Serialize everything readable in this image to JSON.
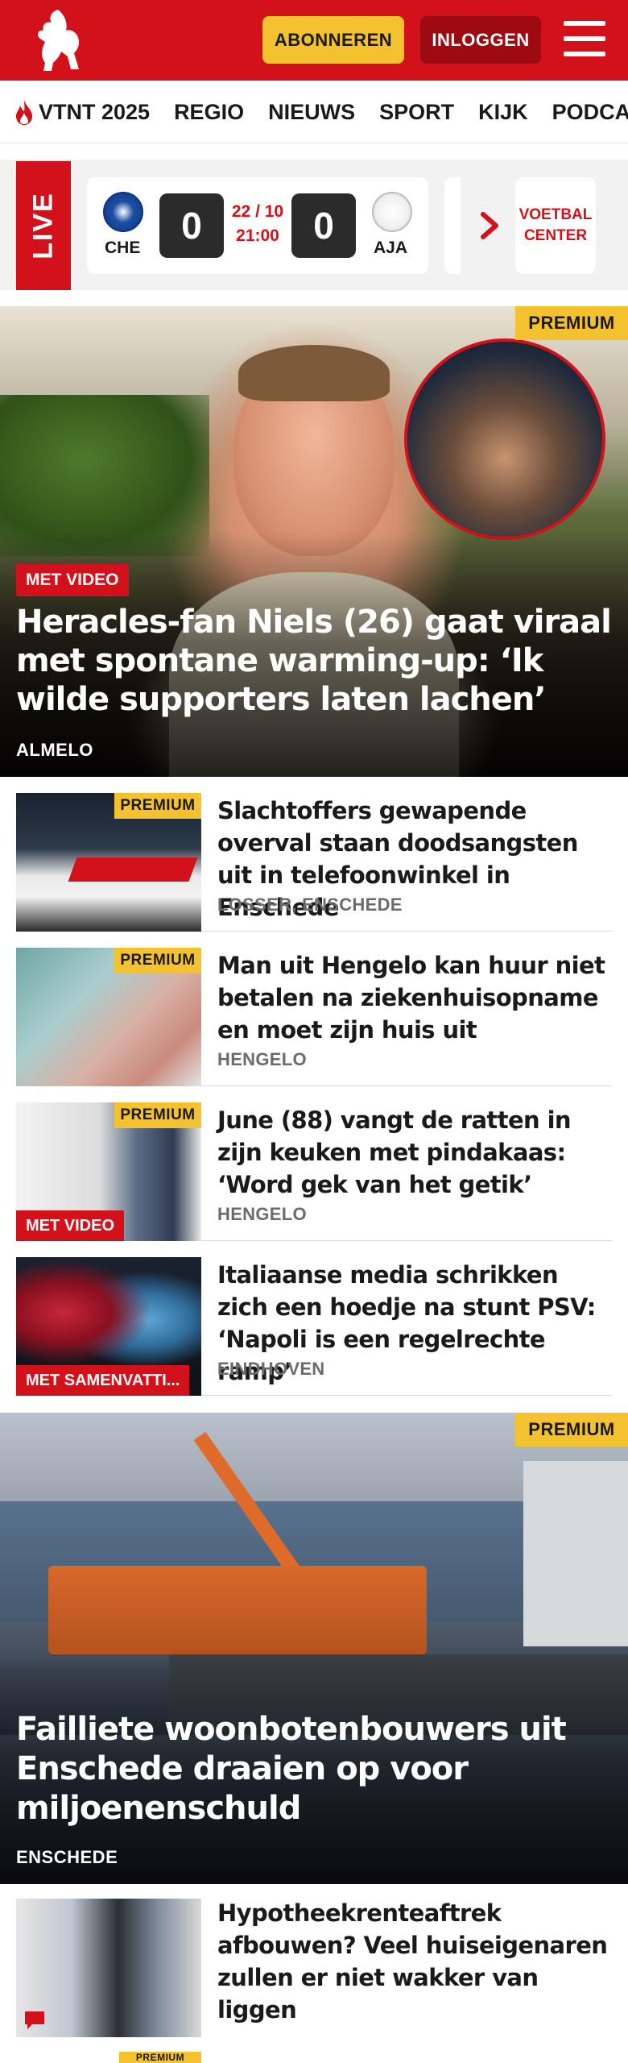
{
  "header": {
    "subscribe_label": "ABONNEREN",
    "login_label": "INLOGGEN",
    "brand_color": "#d3111a",
    "accent_color": "#f4c22e"
  },
  "nav": {
    "items": [
      "VTNT 2025",
      "REGIO",
      "NIEUWS",
      "SPORT",
      "KIJK",
      "PODCAST"
    ]
  },
  "live": {
    "label": "LIVE",
    "match": {
      "home": "CHE",
      "away": "AJA",
      "home_score": "0",
      "away_score": "0",
      "date": "22 / 10",
      "time": "21:00"
    },
    "voetbal_center_line1": "VOETBAL",
    "voetbal_center_line2": "CENTER"
  },
  "hero": {
    "premium_label": "PREMIUM",
    "badge": "MET VIDEO",
    "title": "Heracles-fan Niels (26) gaat viraal met spontane warming-up: ‘Ik wilde supporters laten lachen’",
    "location": "ALMELO"
  },
  "articles": [
    {
      "premium": "PREMIUM",
      "badge": "",
      "title": "Slachtoffers gewapende overval staan doodsangsten uit in telefoonwinkel in Enschede",
      "location": "LOSSER, ENSCHEDE"
    },
    {
      "premium": "PREMIUM",
      "badge": "",
      "title": "Man uit Hengelo kan huur niet betalen na ziekenhuisopname en moet zijn huis uit",
      "location": "HENGELO"
    },
    {
      "premium": "PREMIUM",
      "badge": "MET VIDEO",
      "title": "June (88) vangt de ratten in zijn keuken met pindakaas: ‘Word gek van het getik’",
      "location": "HENGELO"
    },
    {
      "premium": "",
      "badge": "MET SAMENVATTI...",
      "title": "Italiaanse media schrikken zich een hoedje na stunt PSV: ‘Napoli is een regelrechte ramp’",
      "location": "EINDHOVEN"
    }
  ],
  "feature": {
    "premium_label": "PREMIUM",
    "title": "Failliete woonbotenbouwers uit Enschede draaien op voor miljoenen­schuld",
    "location": "ENSCHEDE"
  },
  "article_bottom": {
    "title": "Hypotheekrenteaftrek afbouwen? Veel huiseigenaren zullen er niet wakker van liggen",
    "next_premium": "PREMIUM"
  }
}
